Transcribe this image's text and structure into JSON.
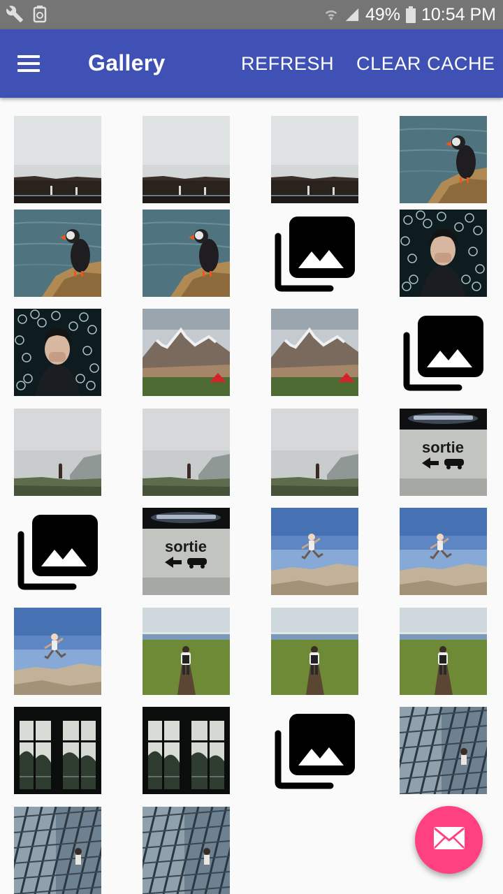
{
  "status_bar": {
    "battery_percent": "49%",
    "time": "10:54 PM",
    "icons": [
      "wrench-icon",
      "recycle-battery-icon",
      "wifi-icon",
      "signal-icon",
      "battery-icon"
    ]
  },
  "app_bar": {
    "title": "Gallery",
    "menu_icon": "hamburger-menu-icon",
    "actions": {
      "refresh": "REFRESH",
      "clear_cache": "CLEAR CACHE"
    },
    "color": "#3f51b5"
  },
  "gallery": {
    "columns": 4,
    "rows": [
      [
        "fog-cliff",
        "fog-cliff",
        "fog-cliff",
        "puffin"
      ],
      [
        "puffin",
        "puffin",
        "placeholder",
        "woman-bubbles"
      ],
      [
        "woman-bubbles",
        "mountains-tent",
        "mountains-tent",
        "placeholder"
      ],
      [
        "foggy-person",
        "foggy-person",
        "foggy-person",
        "sortie-sign"
      ],
      [
        "placeholder",
        "sortie-sign",
        "jumping-man",
        "jumping-man"
      ],
      [
        "jumping-man",
        "hiker-field",
        "hiker-field",
        "hiker-field"
      ],
      [
        "window-frame",
        "window-frame",
        "placeholder",
        "building-facade"
      ],
      [
        "building-facade",
        "building-facade"
      ]
    ],
    "sign_text": "sortie"
  },
  "fab": {
    "icon": "envelope-icon",
    "color": "#ff4081"
  }
}
